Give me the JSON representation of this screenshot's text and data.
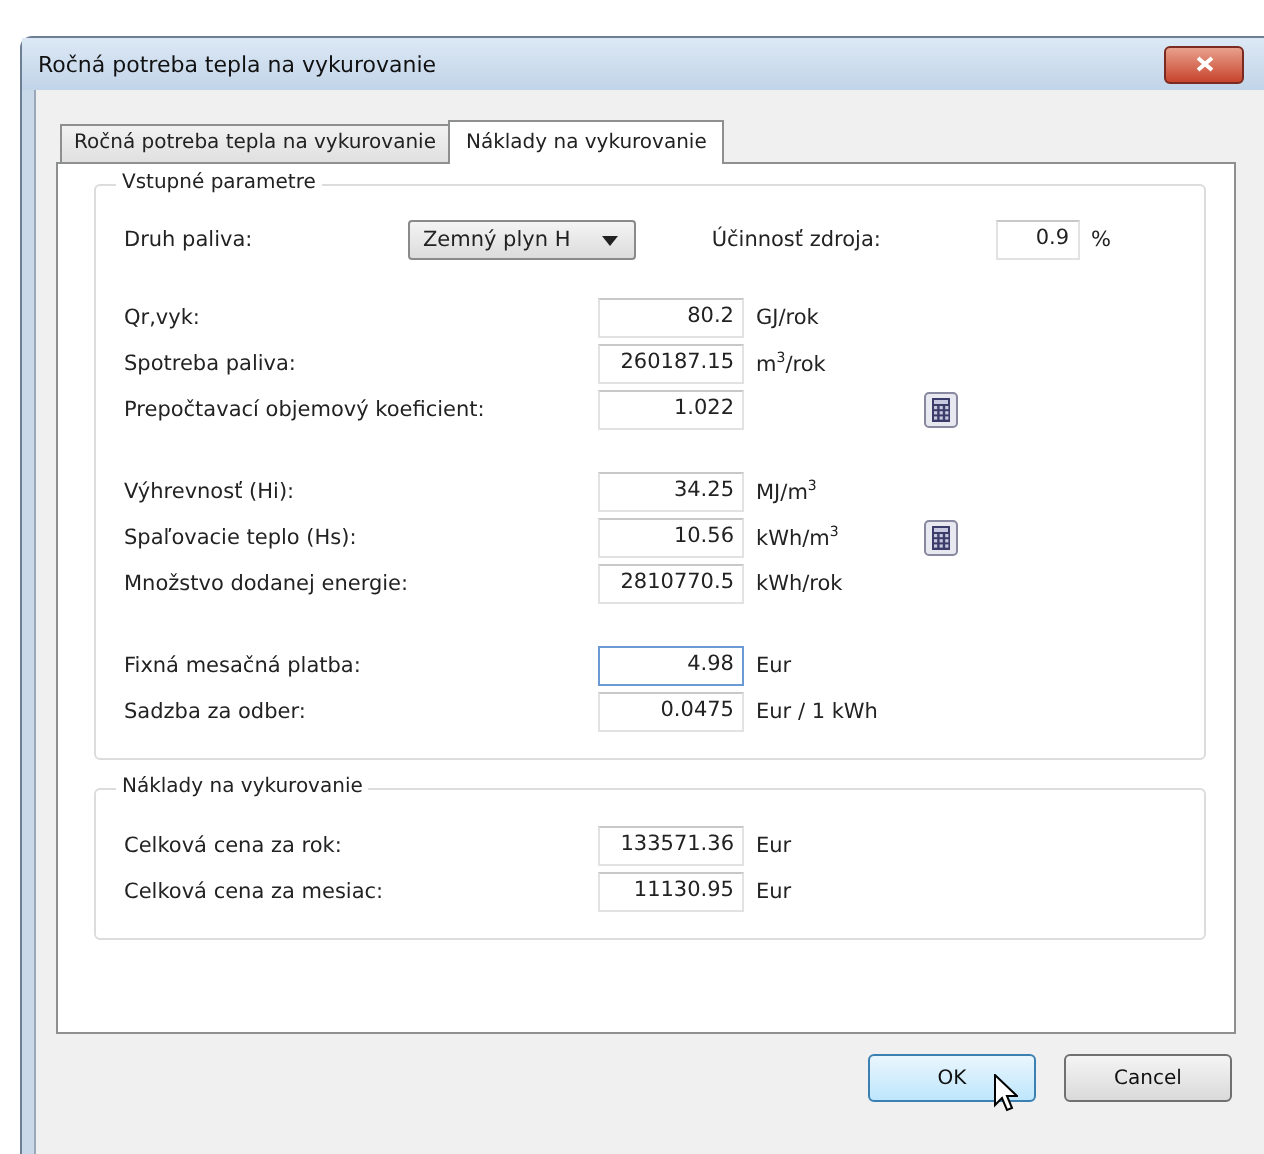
{
  "window": {
    "title": "Ročná potreba tepla na vykurovanie"
  },
  "tabs": [
    {
      "label": "Ročná potreba tepla na vykurovanie",
      "selected": false
    },
    {
      "label": "Náklady na vykurovanie",
      "selected": true
    }
  ],
  "groups": [
    {
      "title": "Vstupné parametre",
      "fuel": {
        "label": "Druh paliva:",
        "value": "Zemný plyn H",
        "efficiency_label": "Účinnosť zdroja:",
        "efficiency_value": "0.9",
        "efficiency_unit": "%"
      },
      "sections": [
        [
          {
            "label": "Qr,vyk:",
            "value": "80.2",
            "unit": "GJ/rok"
          },
          {
            "label": "Spotreba paliva:",
            "value": "260187.15",
            "unit": "m$^{3}$/rok"
          },
          {
            "label": "Prepočtavací objemový koeficient:",
            "value": "1.022",
            "calculator": true
          }
        ],
        [
          {
            "label": "Výhrevnosť (Hi):",
            "value": "34.25",
            "unit": "MJ/m$^{3}$"
          },
          {
            "label": "Spaľovacie teplo (Hs):",
            "value": "10.56",
            "unit": "kWh/m$^{3}$",
            "calculator": true
          },
          {
            "label": "Množstvo dodanej energie:",
            "value": "2810770.5",
            "unit": "kWh/rok"
          }
        ],
        [
          {
            "label": "Fixná mesačná platba:",
            "value": "4.98",
            "unit": "Eur",
            "focused": true
          },
          {
            "label": "Sadzba za odber:",
            "value": "0.0475",
            "unit": "Eur / 1 kWh"
          }
        ]
      ]
    },
    {
      "title": "Náklady na vykurovanie",
      "sections": [
        [
          {
            "label": "Celková cena za rok:",
            "value": "133571.36",
            "unit": "Eur"
          },
          {
            "label": "Celková cena za mesiac:",
            "value": "11130.95",
            "unit": "Eur"
          }
        ]
      ]
    }
  ],
  "buttons": [
    {
      "label": "OK",
      "hovered": true
    },
    {
      "label": "Cancel",
      "hovered": false
    }
  ]
}
